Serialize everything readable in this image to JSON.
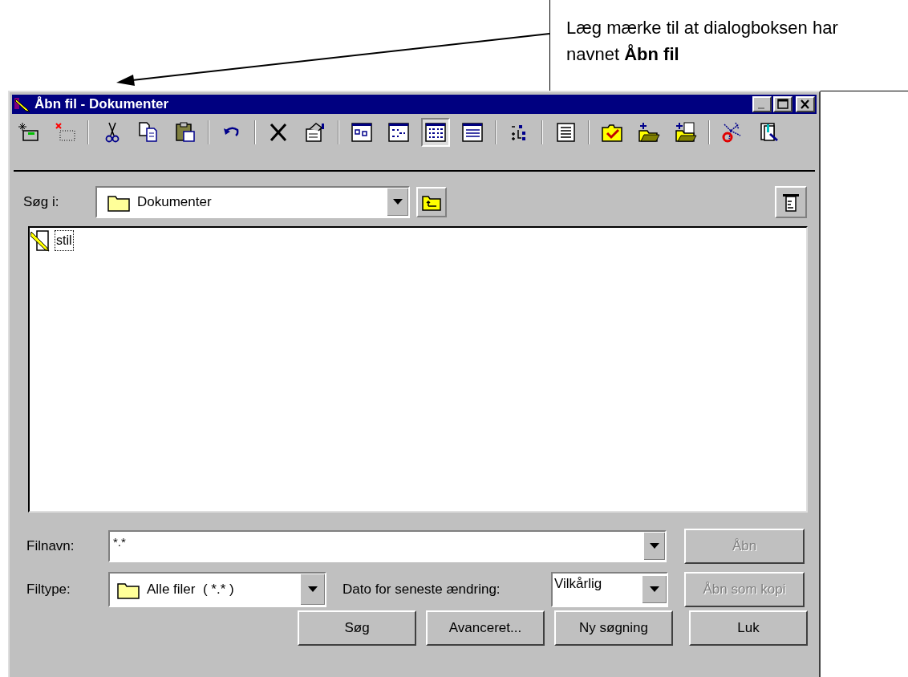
{
  "callout": {
    "text": "Læg mærke til at dialogboksen har navnet **Åbn fil**"
  },
  "window": {
    "title": "Åbn fil - Dokumenter",
    "controls": [
      {
        "kind": "minimize",
        "disabled": true
      },
      {
        "kind": "maximize",
        "disabled": false
      },
      {
        "kind": "close",
        "disabled": false
      }
    ]
  },
  "toolbar": [
    [
      {
        "kind": "new-search",
        "selected": false
      },
      {
        "kind": "delete-search",
        "selected": false
      }
    ],
    [
      {
        "kind": "cut",
        "selected": false
      },
      {
        "kind": "copy",
        "selected": false
      },
      {
        "kind": "paste",
        "selected": false
      }
    ],
    [
      {
        "kind": "undo",
        "selected": false
      }
    ],
    [
      {
        "kind": "delete",
        "selected": false
      },
      {
        "kind": "properties",
        "selected": false
      }
    ],
    [
      {
        "kind": "large-icons",
        "selected": false
      },
      {
        "kind": "small-icons",
        "selected": false
      },
      {
        "kind": "list",
        "selected": true
      },
      {
        "kind": "details",
        "selected": false
      }
    ],
    [
      {
        "kind": "tree",
        "selected": false
      }
    ],
    [
      {
        "kind": "preview",
        "selected": false
      }
    ],
    [
      {
        "kind": "favorites",
        "selected": false
      },
      {
        "kind": "new-folder",
        "selected": false
      },
      {
        "kind": "add-folder",
        "selected": false
      }
    ],
    [
      {
        "kind": "network",
        "selected": false
      },
      {
        "kind": "find",
        "selected": false
      }
    ]
  ],
  "look_in": {
    "label": "Søg i:",
    "value": "Dokumenter"
  },
  "files": [
    {
      "name": "stil",
      "focused": true
    }
  ],
  "filename": {
    "label": "Filnavn:",
    "value": "*.*"
  },
  "filetype": {
    "label": "Filtype:",
    "value": "Alle filer  ( *.* )"
  },
  "date": {
    "label": "Dato for seneste ændring:",
    "value": "Vilkårlig"
  },
  "side_buttons": [
    {
      "label": "Åbn",
      "disabled": true
    },
    {
      "label": "Åbn som kopi",
      "disabled": true
    }
  ],
  "bottom_buttons": [
    {
      "label": "Søg",
      "disabled": false
    },
    {
      "label": "Avanceret...",
      "disabled": false
    },
    {
      "label": "Ny søgning",
      "disabled": false
    },
    {
      "label": "Luk",
      "disabled": false
    }
  ]
}
